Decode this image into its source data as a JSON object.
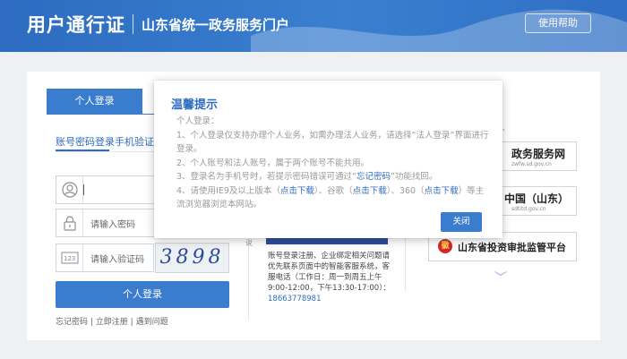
{
  "header": {
    "brand": "用户通行证",
    "portal": "山东省统一政务服务门户",
    "help_button": "使用帮助"
  },
  "login": {
    "tab_personal": "个人登录",
    "subtab_password": "账号密码登录",
    "subtab_phone": "手机验证码",
    "username_placeholder": "",
    "password_placeholder": "请输入密码",
    "captcha_placeholder": "请输入验证码",
    "captcha_image_text": "3898",
    "login_button": "个人登录",
    "links": {
      "forgot": "忘记密码",
      "sep1": " | ",
      "register": "立即注册",
      "sep2": " | ",
      "problem": "遇到问题"
    }
  },
  "middle": {
    "small_label": "说",
    "text": "账号登录注册、企业绑定相关问题请优先联系页面中的智能客服系统，客服电话（工作日：周一到周五上午9:00-12:00，下午13:30-17:00）：",
    "phone": "18663778981"
  },
  "right": {
    "item1": {
      "title": "政务服务网",
      "subtitle": "zwfw.sd.gov.cn"
    },
    "item2": {
      "title": "中国（山东）",
      "subtitle": "sdtitd.gov.cn"
    },
    "item3": {
      "title": "山东省投资审批监管平台",
      "emblem": "徽"
    }
  },
  "modal": {
    "title": "温馨提示",
    "line_heading": "个人登录：",
    "line1": "1、个人登录仅支持办理个人业务，如需办理法人业务，请选择“法人登录”界面进行登录。",
    "line2": "2、个人账号和法人账号，属于两个账号不能共用。",
    "line3_a": "3、登录名为手机号时，若提示密码错误可通过“",
    "line3_link": "忘记密码",
    "line3_b": "”功能找回。",
    "line4_a": "4、请使用IE9及以上版本（",
    "line4_link1": "点击下载",
    "line4_b": "）、谷歌（",
    "line4_link2": "点击下载",
    "line4_c": "）、360（",
    "line4_link3": "点击下载",
    "line4_d": "）等主流浏览器浏览本网站。",
    "close_button": "关闭"
  },
  "colors": {
    "primary": "#3a7dcf",
    "header": "#2d6cc0",
    "link": "#2d6cc0"
  },
  "icons": [
    "user-icon",
    "lock-icon",
    "captcha-icon",
    "chevron-up-icon",
    "chevron-down-icon",
    "emblem-icon"
  ]
}
